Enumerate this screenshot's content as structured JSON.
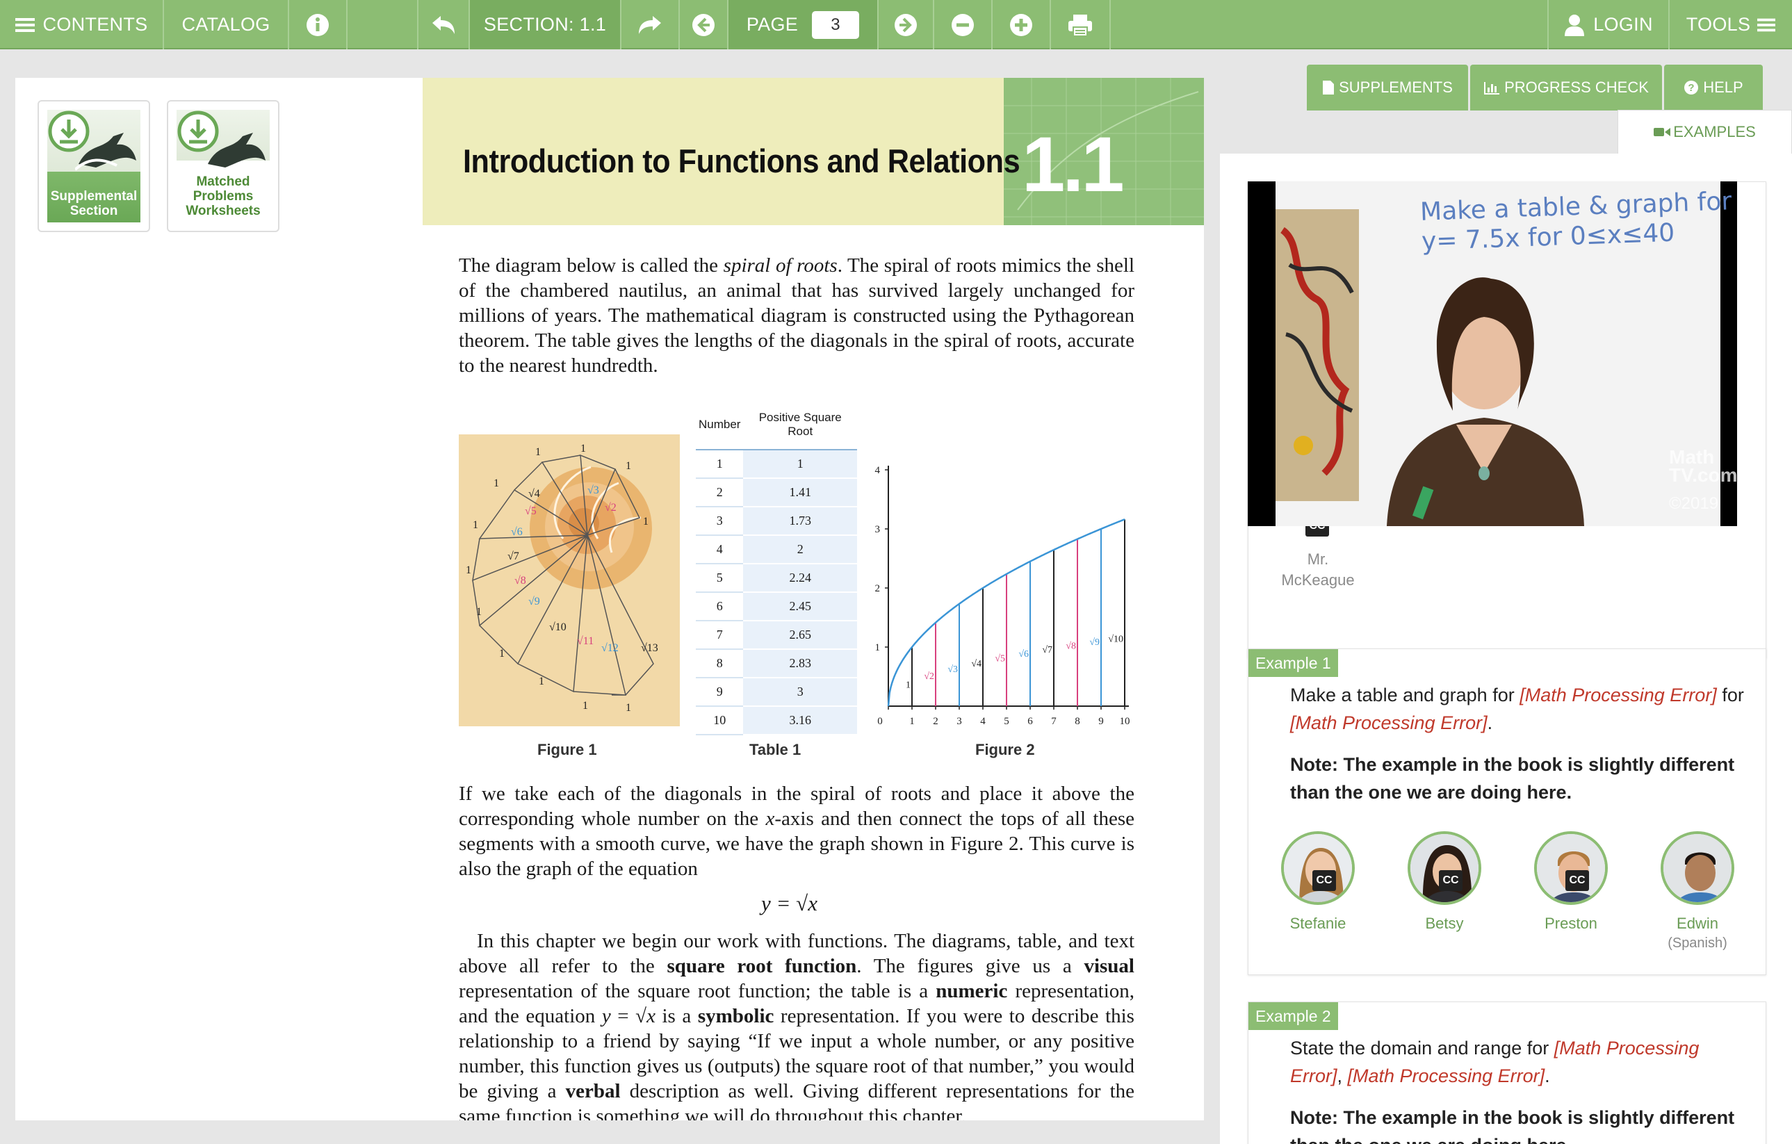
{
  "toolbar": {
    "contents": "CONTENTS",
    "catalog": "CATALOG",
    "section": "SECTION: 1.1",
    "page_label": "PAGE",
    "page_value": "3",
    "login": "LOGIN",
    "tools": "TOOLS"
  },
  "left_panel": {
    "downloads": [
      {
        "caption": "Supplemental Section"
      },
      {
        "caption": "Matched Problems Worksheets"
      }
    ],
    "logo": "box"
  },
  "book": {
    "chapter_title": "Introduction to Functions and Relations",
    "chapter_number": "1.1",
    "figure_captions": [
      "Figure 1",
      "Table 1",
      "Figure 2"
    ],
    "table1": {
      "headers": [
        "Number",
        "Positive Square Root"
      ],
      "rows": [
        [
          "1",
          "1"
        ],
        [
          "2",
          "1.41"
        ],
        [
          "3",
          "1.73"
        ],
        [
          "4",
          "2"
        ],
        [
          "5",
          "2.24"
        ],
        [
          "6",
          "2.45"
        ],
        [
          "7",
          "2.65"
        ],
        [
          "8",
          "2.83"
        ],
        [
          "9",
          "3"
        ],
        [
          "10",
          "3.16"
        ]
      ]
    },
    "equation": "y = √x"
  },
  "chart_data": {
    "type": "line",
    "title": "",
    "x": [
      0,
      1,
      2,
      3,
      4,
      5,
      6,
      7,
      8,
      9,
      10
    ],
    "y": [
      0,
      1,
      1.41,
      1.73,
      2,
      2.24,
      2.45,
      2.65,
      2.83,
      3,
      3.16
    ],
    "segment_labels": [
      "1",
      "√2",
      "√3",
      "√4",
      "√5",
      "√6",
      "√7",
      "√8",
      "√9",
      "√10"
    ],
    "xlim": [
      0,
      10
    ],
    "ylim": [
      0,
      4
    ],
    "xticks": [
      "0",
      "1",
      "2",
      "3",
      "4",
      "5",
      "6",
      "7",
      "8",
      "9",
      "10"
    ],
    "yticks": [
      "1",
      "2",
      "3",
      "4"
    ],
    "colors": {
      "curve": "#3b95d6",
      "black": "#222222",
      "pink": "#d8407e",
      "blue": "#3b95d6"
    }
  },
  "right_panel": {
    "tabs": [
      "SUPPLEMENTS",
      "PROGRESS CHECK",
      "HELP",
      "EXAMPLES"
    ],
    "video": {
      "board_line1": "Make a table & graph for",
      "board_line2": "y= 7.5x for 0≤x≤40",
      "watermark": "Math TV.com",
      "copyright": "©2019"
    },
    "presenter": {
      "name": "Mr. McKeague",
      "cc": "CC"
    },
    "examples": [
      {
        "tag": "Example 1",
        "text_a": "Make a table and graph for ",
        "err1": "[Math Processing Error]",
        "text_b": " for ",
        "err2": "[Math Processing Error]",
        "text_c": ".",
        "note": "Note: The example in the book is slightly different than the one we are doing here.",
        "tutors": [
          {
            "name": "Stefanie",
            "sub": "",
            "cc": "CC"
          },
          {
            "name": "Betsy",
            "sub": "",
            "cc": "CC"
          },
          {
            "name": "Preston",
            "sub": "",
            "cc": "CC"
          },
          {
            "name": "Edwin",
            "sub": "(Spanish)",
            "cc": ""
          }
        ]
      },
      {
        "tag": "Example 2",
        "text_a": "State the domain and range for ",
        "err1": "[Math Processing Error]",
        "text_b": ", ",
        "err2": "[Math Processing Error]",
        "text_c": ".",
        "note": "Note: The example in the book is slightly different than the one we are doing here."
      }
    ]
  }
}
